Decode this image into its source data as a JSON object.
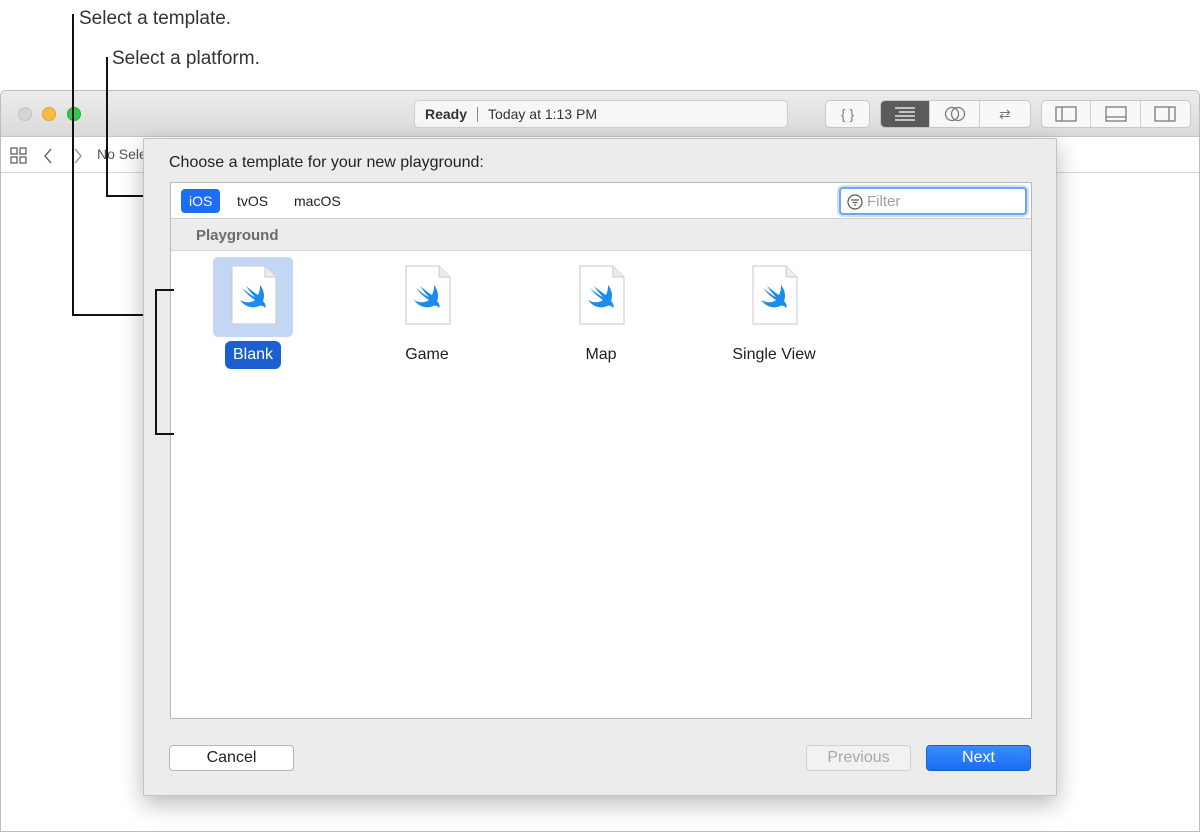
{
  "callouts": {
    "template": "Select a template.",
    "platform": "Select a platform."
  },
  "toolbar": {
    "status": "Ready",
    "time": "Today at 1:13 PM",
    "editor_buttons": [
      "{ }",
      "",
      "",
      "⇄"
    ]
  },
  "navbar": {
    "selection": "No Sele"
  },
  "sheet": {
    "title": "Choose a template for your new playground:",
    "platforms": [
      "iOS",
      "tvOS",
      "macOS"
    ],
    "selected_platform": "iOS",
    "filter_placeholder": "Filter",
    "section": "Playground",
    "templates": [
      {
        "label": "Blank",
        "selected": true
      },
      {
        "label": "Game",
        "selected": false
      },
      {
        "label": "Map",
        "selected": false
      },
      {
        "label": "Single View",
        "selected": false
      }
    ],
    "buttons": {
      "cancel": "Cancel",
      "previous": "Previous",
      "next": "Next"
    }
  },
  "colors": {
    "accent": "#1b6ef5",
    "swift_bird": "#1a8cf0",
    "selection_bg": "#c3d7f4"
  }
}
